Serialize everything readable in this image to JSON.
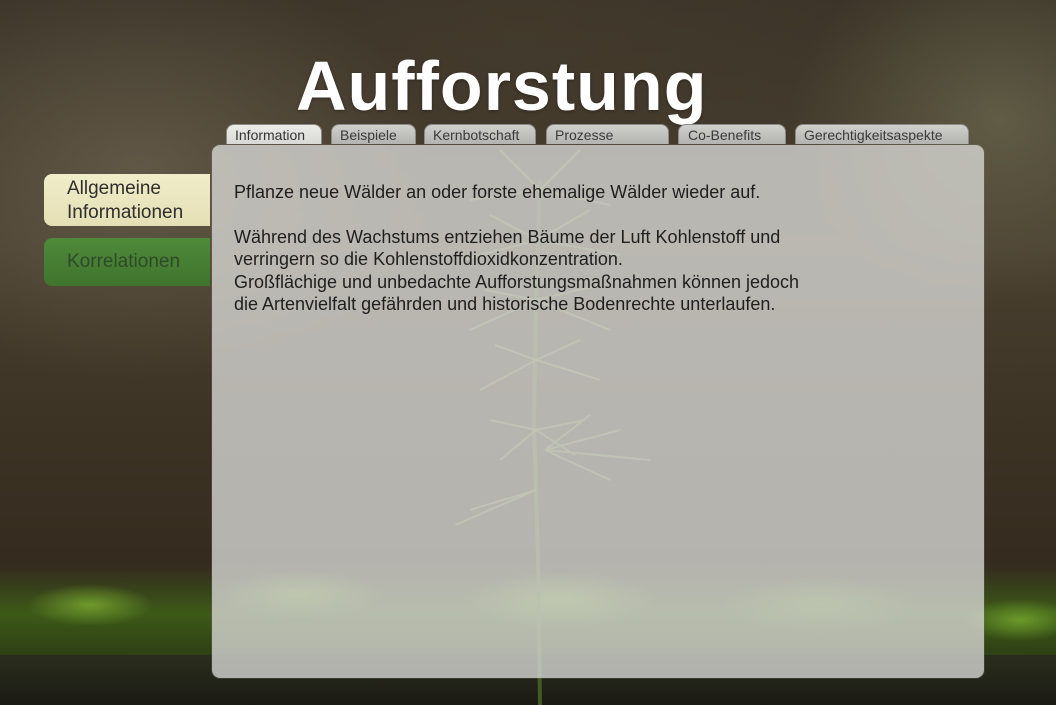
{
  "title": "Aufforstung",
  "tabs": [
    {
      "label": "Information",
      "active": true
    },
    {
      "label": "Beispiele",
      "active": false
    },
    {
      "label": "Kernbotschaft",
      "active": false
    },
    {
      "label": "Prozesse",
      "active": false
    },
    {
      "label": "Co-Benefits",
      "active": false
    },
    {
      "label": "Gerechtigkeitsaspekte",
      "active": false
    }
  ],
  "sidebar": {
    "general_info_line1": "Allgemeine",
    "general_info_line2": "Informationen",
    "correlations": "Korrelationen"
  },
  "content": {
    "intro": "Pflanze neue Wälder an oder forste ehemalige Wälder wieder auf.",
    "line1": "Während des Wachstums entziehen Bäume der Luft Kohlenstoff und",
    "line2": "verringern so die Kohlenstoffdioxidkonzentration.",
    "line3": "Großflächige und unbedachte Aufforstungsmaßnahmen können jedoch",
    "line4": "die Artenvielfalt gefährden und historische Bodenrechte unterlaufen."
  },
  "colors": {
    "active_sidebar": "#e9e4bd",
    "inactive_sidebar": "#478033",
    "panel": "#d6d6d2"
  }
}
